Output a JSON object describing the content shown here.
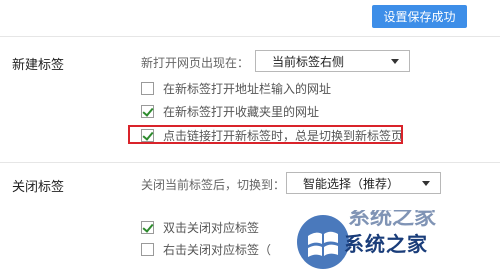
{
  "toolbar": {
    "save_label": "设置保存成功"
  },
  "new_tab": {
    "title": "新建标签",
    "open_label": "新打开网页出现在：",
    "open_select_value": "当前标签右侧",
    "options": [
      {
        "label": "在新标签打开地址栏输入的网址",
        "checked": false
      },
      {
        "label": "在新标签打开收藏夹里的网址",
        "checked": true
      },
      {
        "label": "点击链接打开新标签时，总是切换到新标签页",
        "checked": true
      }
    ]
  },
  "close_tab": {
    "title": "关闭标签",
    "after_close_label": "关闭当前标签后，切换到：",
    "after_close_select_value": "智能选择（推荐）",
    "options": [
      {
        "label": "双击关闭对应标签",
        "checked": true
      },
      {
        "label": "右击关闭对应标签（",
        "checked": false
      }
    ]
  },
  "watermark": {
    "text": "系统之家",
    "partial_text": "系统之家"
  }
}
